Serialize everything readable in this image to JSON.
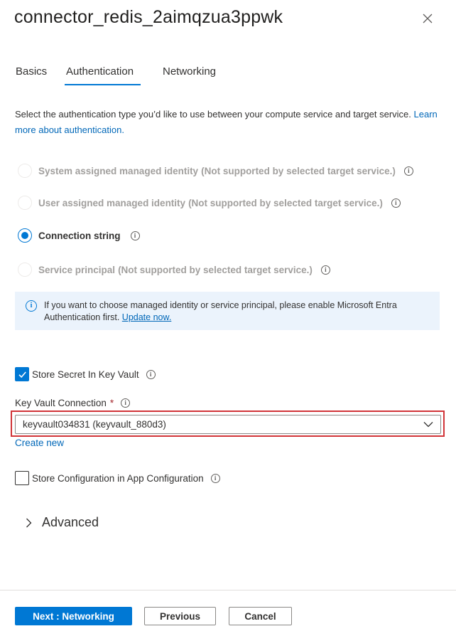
{
  "header": {
    "title": "connector_redis_2aimqzua3ppwk",
    "close_icon": "close-icon"
  },
  "tabs": [
    {
      "label": "Basics",
      "active": false
    },
    {
      "label": "Authentication",
      "active": true
    },
    {
      "label": "Networking",
      "active": false
    }
  ],
  "description": {
    "text": "Select the authentication type you’d like to use between your compute service and target service.",
    "link": "Learn more about authentication."
  },
  "auth_options": [
    {
      "label": "System assigned managed identity",
      "note": "(Not supported by selected target service.)",
      "selected": false,
      "enabled": false
    },
    {
      "label": "User assigned managed identity",
      "note": "(Not supported by selected target service.)",
      "selected": false,
      "enabled": false
    },
    {
      "label": "Connection string",
      "note": "",
      "selected": true,
      "enabled": true
    },
    {
      "label": "Service principal",
      "note": "(Not supported by selected target service.)",
      "selected": false,
      "enabled": false
    }
  ],
  "info_banner": {
    "text": "If you want to choose managed identity or service principal, please enable Microsoft Entra Authentication first.",
    "link": "Update now."
  },
  "store_secret": {
    "label": "Store Secret In Key Vault",
    "checked": true
  },
  "key_vault": {
    "label": "Key Vault Connection",
    "required_mark": "*",
    "value": "keyvault034831 (keyvault_880d3)",
    "create_new": "Create new"
  },
  "store_config": {
    "label": "Store Configuration in App Configuration",
    "checked": false
  },
  "advanced": {
    "label": "Advanced"
  },
  "footer": {
    "next": "Next : Networking",
    "previous": "Previous",
    "cancel": "Cancel"
  },
  "colors": {
    "accent": "#0078d4",
    "highlight_border": "#d13438",
    "info_bg": "#ebf3fc"
  }
}
